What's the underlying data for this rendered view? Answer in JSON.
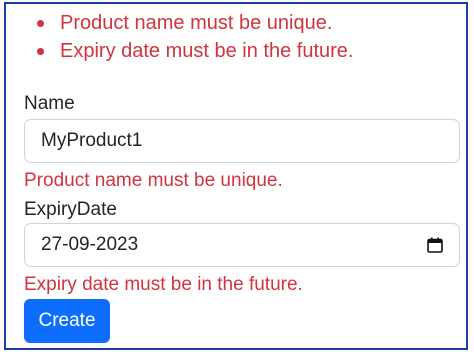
{
  "validation_summary": {
    "errors": [
      "Product name must be unique.",
      "Expiry date must be in the future."
    ]
  },
  "form": {
    "name": {
      "label": "Name",
      "value": "MyProduct1",
      "error": "Product name must be unique."
    },
    "expiry_date": {
      "label": "ExpiryDate",
      "value": "27-09-2023",
      "error": "Expiry date must be in the future.",
      "icon": "calendar-icon"
    },
    "submit_label": "Create"
  },
  "colors": {
    "error": "#d1343e",
    "primary": "#0d6efd",
    "frame_border": "#1f3fa6"
  }
}
